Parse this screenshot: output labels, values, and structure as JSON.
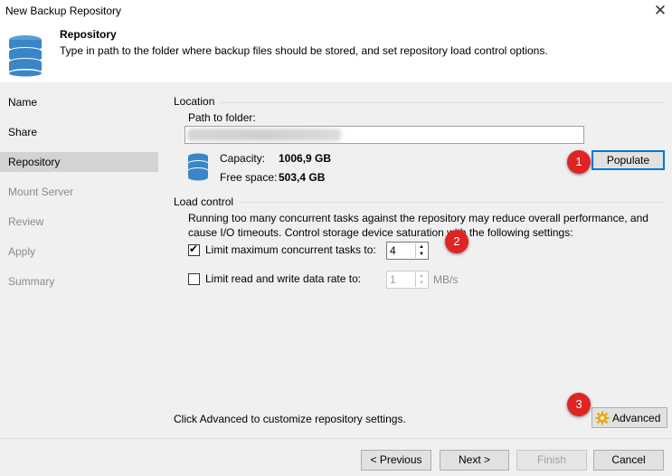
{
  "window": {
    "title": "New Backup Repository",
    "close_glyph": "✕"
  },
  "header": {
    "icon": "database-icon",
    "title": "Repository",
    "description": "Type in path to the folder where backup files should be stored, and set repository load control options."
  },
  "sidebar": {
    "items": [
      {
        "label": "Name",
        "state": "normal"
      },
      {
        "label": "Share",
        "state": "normal"
      },
      {
        "label": "Repository",
        "state": "active"
      },
      {
        "label": "Mount Server",
        "state": "disabled"
      },
      {
        "label": "Review",
        "state": "disabled"
      },
      {
        "label": "Apply",
        "state": "disabled"
      },
      {
        "label": "Summary",
        "state": "disabled"
      }
    ]
  },
  "location": {
    "group_label": "Location",
    "path_label": "Path to folder:",
    "path_value": "",
    "capacity_label": "Capacity:",
    "capacity_value": "1006,9 GB",
    "free_label": "Free space:",
    "free_value": "503,4 GB",
    "populate_label": "Populate"
  },
  "load_control": {
    "group_label": "Load control",
    "description_line1": "Running too many concurrent tasks against the repository may reduce overall performance, and",
    "description_line2": "cause I/O timeouts. Control storage device saturation with the following settings:",
    "limit_tasks_label": "Limit maximum concurrent tasks to:",
    "limit_tasks_checked": true,
    "limit_tasks_value": "4",
    "limit_rate_label": "Limit read and write data rate to:",
    "limit_rate_checked": false,
    "limit_rate_value": "1",
    "limit_rate_unit": "MB/s"
  },
  "advanced": {
    "hint": "Click Advanced to customize repository settings.",
    "button_label": "Advanced",
    "icon": "gear-icon"
  },
  "annotations": [
    "1",
    "2",
    "3"
  ],
  "footer": {
    "previous_label": "< Previous",
    "next_label": "Next >",
    "finish_label": "Finish",
    "cancel_label": "Cancel"
  },
  "colors": {
    "badge": "#e02424",
    "accent": "#0078d7",
    "panel": "#f0f0f0",
    "db_icon": "#3a86c8"
  }
}
